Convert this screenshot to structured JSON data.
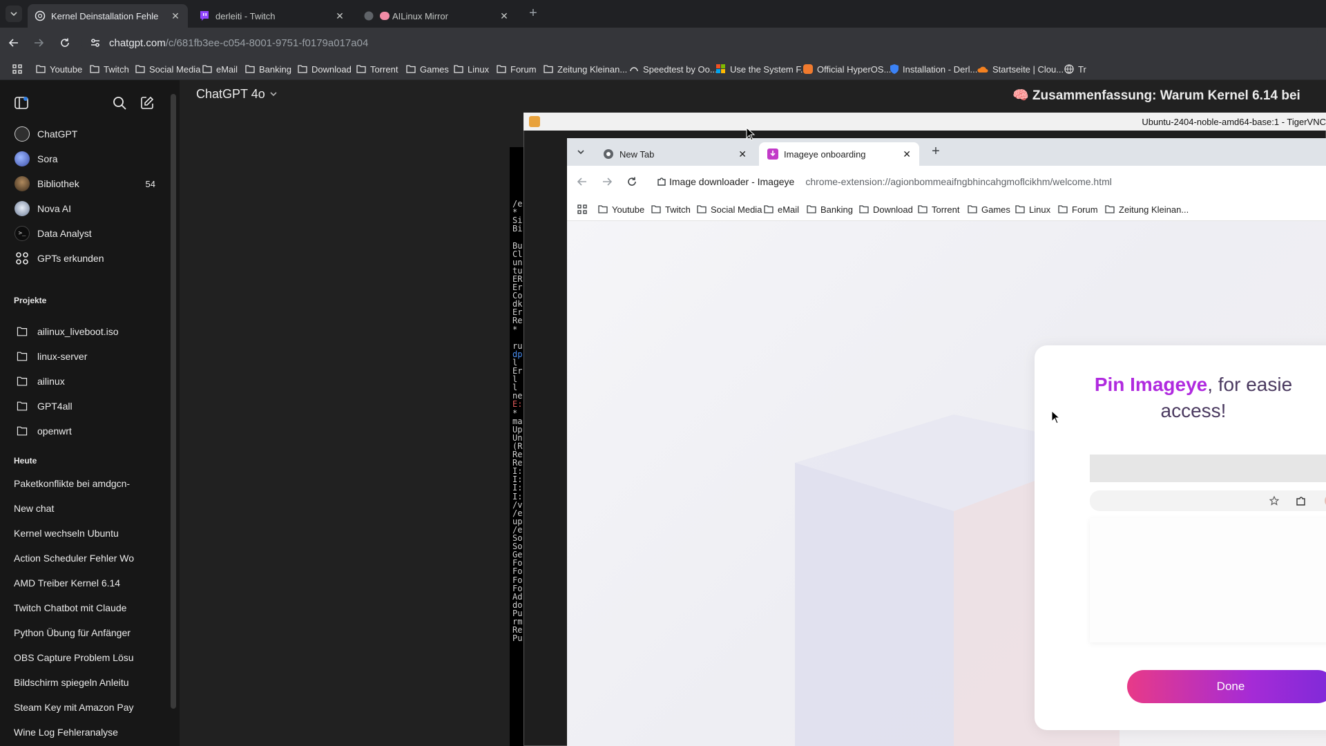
{
  "outer_browser": {
    "tabs": [
      {
        "title": "Kernel Deinstallation Fehle",
        "active": true,
        "icon": "chatgpt-icon"
      },
      {
        "title": "derleiti - Twitch",
        "active": false,
        "icon": "twitch-icon"
      },
      {
        "title": "AILinux Mirror",
        "active": false,
        "icon": "brain-icon"
      }
    ],
    "new_tab_symbol": "+",
    "close_symbol": "✕",
    "url_host": "chatgpt.com",
    "url_path": "/c/681fb3ee-c054-8001-9751-f0179a017a04",
    "bookmarks": [
      "Youtube",
      "Twitch",
      "Social Media",
      "eMail",
      "Banking",
      "Download",
      "Torrent",
      "Games",
      "Linux",
      "Forum",
      "Zeitung Kleinan...",
      "Speedtest by Oo...",
      "Use the System F...",
      "Official HyperOS...",
      "Installation - Derl...",
      "Startseite | Clou...",
      "Tr"
    ]
  },
  "sidebar": {
    "items": [
      {
        "label": "ChatGPT",
        "icon": "chatgpt-logo-icon"
      },
      {
        "label": "Sora",
        "icon": "sora-avatar"
      },
      {
        "label": "Bibliothek",
        "icon": "library-avatar",
        "count": "54"
      },
      {
        "label": "Nova AI",
        "icon": "nova-avatar"
      },
      {
        "label": "Data Analyst",
        "icon": "terminal-avatar"
      },
      {
        "label": "GPTs erkunden",
        "icon": "grid-icon"
      }
    ],
    "projects_heading": "Projekte",
    "projects": [
      "ailinux_liveboot.iso",
      "linux-server",
      "ailinux",
      "GPT4all",
      "openwrt"
    ],
    "today_heading": "Heute",
    "chats": [
      "Paketkonflikte bei amdgcn-",
      "New chat",
      "Kernel wechseln Ubuntu",
      "Action Scheduler Fehler Wo",
      "AMD Treiber Kernel 6.14",
      "Twitch Chatbot mit Claude",
      "Python Übung für Anfänger",
      "OBS Capture Problem Lösu",
      "Bildschirm spiegeln Anleitu",
      "Steam Key mit Amazon Pay",
      "Wine Log Fehleranalyse"
    ]
  },
  "header": {
    "model": "ChatGPT 4o",
    "conversation_title": "🧠 Zusammenfassung: Warum Kernel 6.14 bei"
  },
  "vnc": {
    "window_title": "Ubuntu-2404-noble-amd64-base:1 - TigerVNC",
    "terminal_lines": [
      "/e",
      " *",
      "Si",
      "Bi",
      "",
      "Bu",
      "Cl",
      "un",
      "tu",
      "ER",
      "Er",
      "Co",
      "dk",
      "Er",
      "Re",
      " *",
      "",
      "ru",
      "dp",
      " l",
      "Er",
      " l",
      " l",
      "ne",
      "E:",
      " *",
      "ma",
      "Up",
      "Un",
      "(R",
      "Re",
      "Re",
      "I:",
      "I:",
      "I:",
      "I:",
      "/v",
      "/e",
      "up",
      "/e",
      "So",
      "So",
      "Ge",
      "Fo",
      "Fo",
      "Fo",
      "Fo",
      "Ad",
      "do",
      "Pu",
      "rm",
      "Re",
      "Pu"
    ]
  },
  "inner_browser": {
    "tabs": [
      {
        "title": "New Tab",
        "active": false,
        "icon": "chrome-icon"
      },
      {
        "title": "Imageye onboarding",
        "active": true,
        "icon": "imageye-icon"
      }
    ],
    "new_tab_symbol": "+",
    "close_symbol": "✕",
    "site_label": "Image downloader - Imageye",
    "url": "chrome-extension://agionbommeaifngbhincahgmoflcikhm/welcome.html",
    "bookmarks": [
      "Youtube",
      "Twitch",
      "Social Media",
      "eMail",
      "Banking",
      "Download",
      "Torrent",
      "Games",
      "Linux",
      "Forum",
      "Zeitung Kleinan..."
    ]
  },
  "onboarding": {
    "headline_brand": "Pin Imageye",
    "headline_rest": ", for easie",
    "headline_line2": "access!",
    "done_label": "Done",
    "brand_color": "#b02adf"
  }
}
